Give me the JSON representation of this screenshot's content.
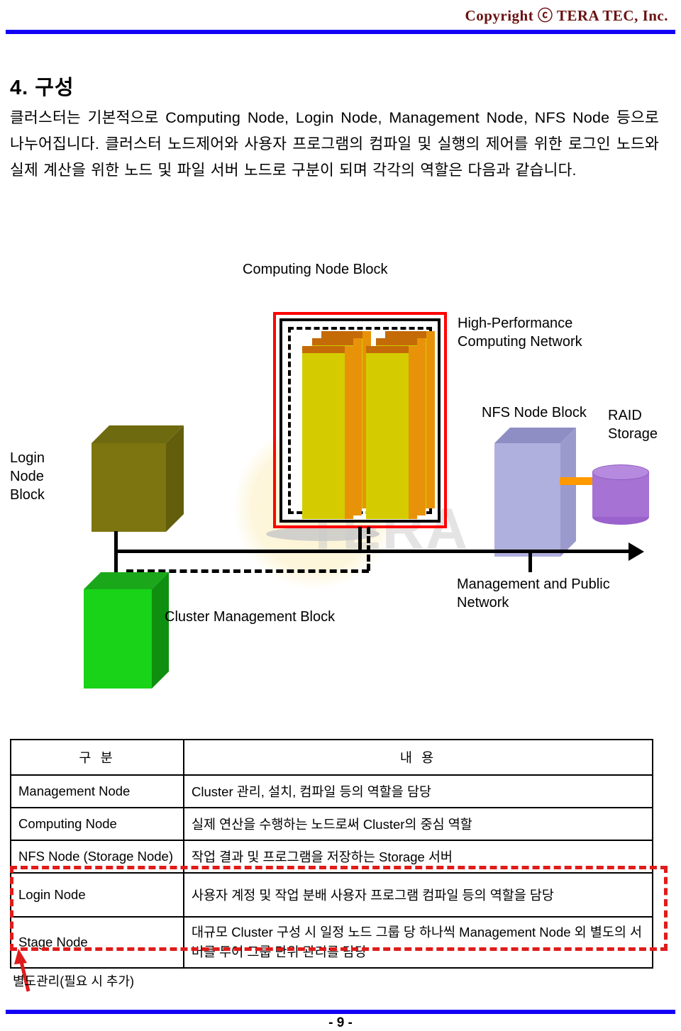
{
  "header": {
    "copyright": "Copyright ⓒ TERA TEC, Inc."
  },
  "section": {
    "title": "4. 구성",
    "paragraph": "클러스터는 기본적으로 Computing Node, Login Node, Management Node, NFS Node 등으로 나누어집니다. 클러스터 노드제어와 사용자 프로그램의 컴파일 및 실행의 제어를 위한 로그인 노드와 실제 계산을 위한 노드 및 파일 서버 노드로 구분이 되며 각각의 역할은 다음과 같습니다."
  },
  "diagram": {
    "watermark": "TERA",
    "labels": {
      "computing_node_block": "Computing Node Block",
      "hpc_network": "High-Performance\nComputing Network",
      "nfs_node_block": "NFS Node Block",
      "raid_storage": "RAID\nStorage",
      "login_node_block": "Login\nNode\nBlock",
      "cluster_management_block": "Cluster Management Block",
      "management_public_network": "Management and Public\nNetwork"
    },
    "colors": {
      "computing_outline": "#ff0000",
      "rack_front": "#d4cc00",
      "rack_side": "#e8920a",
      "rack_top": "#c46a07",
      "login_node": "#7d7510",
      "management_node": "#18d318",
      "nfs_node": "#a8a8d8",
      "raid_storage": "#a672d4",
      "raid_link": "#ff9900",
      "network_line": "#000000"
    }
  },
  "table": {
    "headers": [
      "구 분",
      "내 용"
    ],
    "rows": [
      {
        "category": "Management Node",
        "description": "Cluster 관리, 설치, 컴파일 등의 역할을 담당"
      },
      {
        "category": "Computing Node",
        "description": "실제 연산을 수행하는 노드로써 Cluster의 중심 역할"
      },
      {
        "category": "NFS Node (Storage Node)",
        "description": "작업 결과 및 프로그램을 저장하는 Storage 서버"
      },
      {
        "category": "Login Node",
        "description": "사용자 계정 및 작업 분배 사용자 프로그램 컴파일 등의 역할을 담당"
      },
      {
        "category": "Stage Node",
        "description": "대규모 Cluster 구성 시 일정 노드 그룹 당 하나씩 Management Node 외 별도의 서버를 두어 그룹 단위 관리를 담당"
      }
    ]
  },
  "annotation": {
    "caption": "별도관리(필요 시 추가)",
    "color": "#e01b1b"
  },
  "footer": {
    "page_number": "- 9 -",
    "rule_color": "#1300f5"
  }
}
